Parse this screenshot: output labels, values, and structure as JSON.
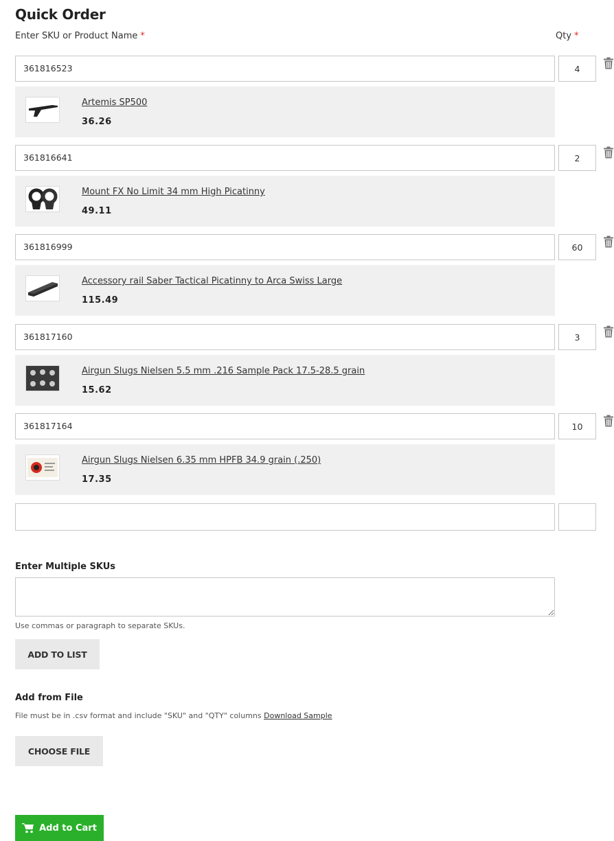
{
  "title": "Quick Order",
  "labels": {
    "sku": "Enter SKU or Product Name",
    "qty": "Qty",
    "required_mark": "*"
  },
  "rows": [
    {
      "sku": "361816523",
      "qty": "4",
      "product": {
        "name": "Artemis SP500",
        "price": "36.26",
        "image_icon": "air-pistol-icon"
      }
    },
    {
      "sku": "361816641",
      "qty": "2",
      "product": {
        "name": "Mount FX No Limit 34 mm High Picatinny",
        "price": "49.11",
        "image_icon": "scope-rings-icon"
      }
    },
    {
      "sku": "361816999",
      "qty": "60",
      "product": {
        "name": "Accessory rail Saber Tactical Picatinny to Arca Swiss Large",
        "price": "115.49",
        "image_icon": "rail-icon"
      }
    },
    {
      "sku": "361817160",
      "qty": "3",
      "product": {
        "name": "Airgun Slugs Nielsen 5.5 mm .216 Sample Pack 17.5-28.5 grain",
        "price": "15.62",
        "image_icon": "slug-pack-icon"
      }
    },
    {
      "sku": "361817164",
      "qty": "10",
      "product": {
        "name": "Airgun Slugs Nielsen 6.35 mm HPFB 34.9 grain (.250)",
        "price": "17.35",
        "image_icon": "slug-box-icon"
      }
    }
  ],
  "empty_row": {
    "sku": "",
    "qty": ""
  },
  "multi": {
    "label": "Enter Multiple SKUs",
    "value": "",
    "hint": "Use commas or paragraph to separate SKUs.",
    "button": "ADD TO LIST"
  },
  "file": {
    "label": "Add from File",
    "hint": "File must be in .csv format and include \"SKU\" and \"QTY\" columns",
    "link": "Download Sample",
    "button": "CHOOSE FILE"
  },
  "cart_button": "Add to Cart",
  "colors": {
    "accent": "#2ab02a",
    "required": "#e02b27",
    "panel": "#f0f0f0"
  }
}
